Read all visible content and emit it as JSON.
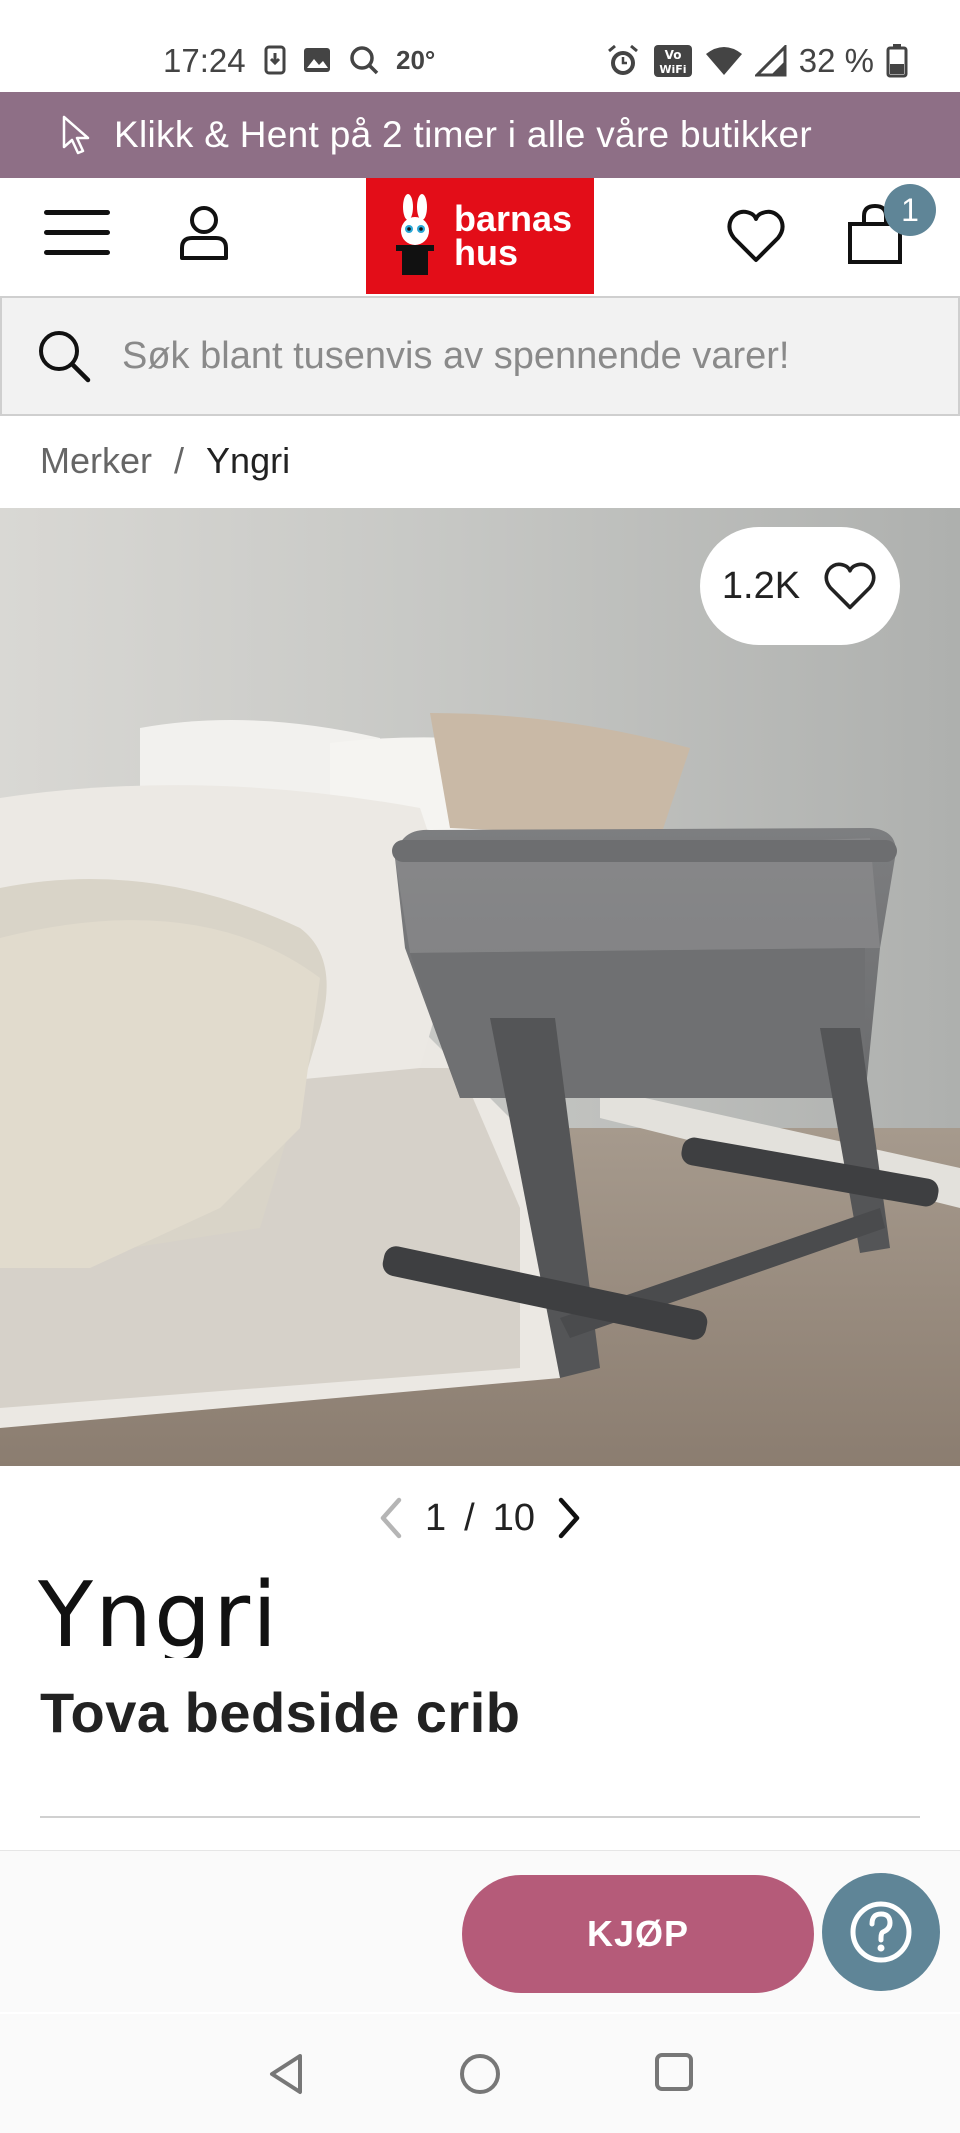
{
  "status_bar": {
    "time": "17:24",
    "temperature": "20°",
    "battery": "32 %",
    "left_icons": [
      "download-notification-icon",
      "image-notification-icon",
      "search-notification-icon"
    ],
    "right_icons": [
      "alarm-icon",
      "vowifi-icon",
      "wifi-icon",
      "signal-icon",
      "battery-icon"
    ]
  },
  "promo": {
    "text": "Klikk & Hent på 2 timer i alle våre butikker",
    "background": "#8e6f86"
  },
  "header": {
    "logo_line1": "barnas",
    "logo_line2": "hus",
    "logo_color": "#e30d18",
    "cart_count": "1",
    "badge_color": "#5f8597"
  },
  "search": {
    "placeholder": "Søk blant tusenvis av spennende varer!"
  },
  "breadcrumb": {
    "items": [
      "Merker",
      "Yngri"
    ],
    "separator": "/"
  },
  "gallery": {
    "like_count": "1.2K",
    "current_page": "1",
    "total_pages": "10",
    "image_subject": "grey bedside crib next to bed"
  },
  "product": {
    "brand": "Yngri",
    "title": "Tova bedside crib"
  },
  "actions": {
    "buy_label": "KJØP",
    "buy_color": "#b55b79",
    "help_color": "#5f8597"
  },
  "nav_bar": {
    "buttons": [
      "back-icon",
      "home-icon",
      "recents-icon"
    ]
  }
}
